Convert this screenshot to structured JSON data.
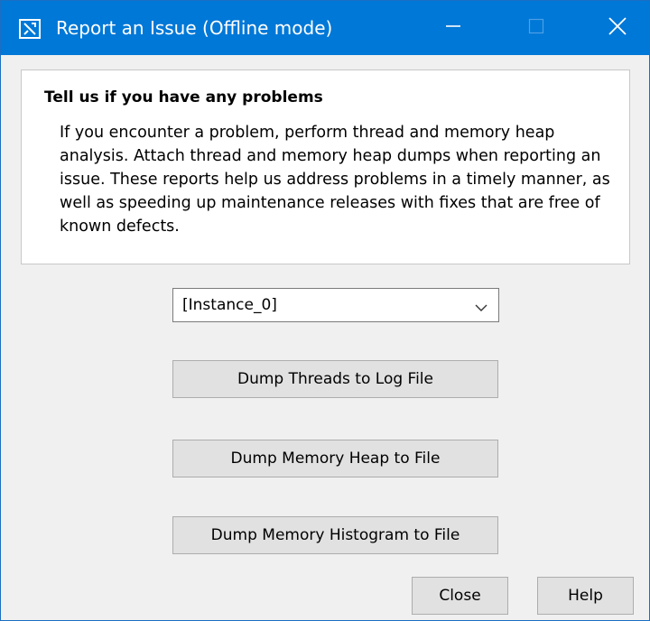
{
  "window": {
    "title": "Report an Issue (Offline mode)"
  },
  "info": {
    "heading": "Tell us if you have any problems",
    "body": "If you encounter a problem, perform thread and memory heap analysis. Attach thread and memory heap dumps when reporting an issue. These reports help us address problems in a timely manner, as well as speeding up maintenance releases with fixes that are free of known defects."
  },
  "instance_select": {
    "selected": "[Instance_0]"
  },
  "actions": {
    "dump_threads": "Dump Threads to Log File",
    "dump_heap": "Dump Memory Heap to File",
    "dump_histogram": "Dump Memory Histogram to File"
  },
  "footer": {
    "close": "Close",
    "help": "Help"
  },
  "colors": {
    "titlebar": "#0078d7",
    "dialog_background": "#f0f0f0",
    "button_face": "#e1e1e1"
  },
  "icons": {
    "app": "report-issue-app-icon",
    "minimize": "minimize-icon",
    "maximize": "maximize-icon",
    "close": "close-icon",
    "dropdown": "chevron-down-icon"
  }
}
